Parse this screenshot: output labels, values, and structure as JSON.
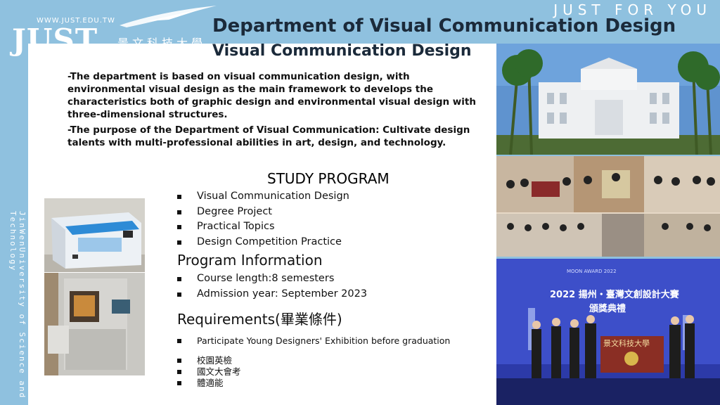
{
  "header": {
    "logo_text": "JUST",
    "logo_url": "WWW.JUST.EDU.TW",
    "logo_chinese": "景文科技大學",
    "slogan": "JUST FOR YOU",
    "title": "Department of Visual Communication Design",
    "subtitle": "Visual Communication Design"
  },
  "side_text": "JinWenUniversity of Science and Technology",
  "intro": {
    "p1": "-The department is based on visual communication design, with environmental visual design as the main framework to develops the characteristics both of graphic design and environmental visual design with three-dimensional structures.",
    "p2": "-The purpose of the Department of Visual Communication: Cultivate design talents with multi-professional abilities in art, design, and technology."
  },
  "study_program": {
    "heading": "STUDY PROGRAM",
    "items": [
      "Visual Communication Design",
      "Degree Project",
      "Practical Topics",
      "Design Competition Practice"
    ]
  },
  "program_info": {
    "heading": "Program Information",
    "items": [
      "Course length:8 semesters",
      "Admission year: September 2023"
    ]
  },
  "requirements": {
    "heading": "Requirements(畢業條件)",
    "items": [
      "Participate Young Designers' Exhibition before graduation"
    ],
    "items_cn": [
      "校園英檢",
      "國文大會考",
      "體適能"
    ]
  },
  "photos": {
    "award_banner_line1": "2022 揚州・臺灣文創設計大賽",
    "award_banner_line2": "頒獎典禮",
    "award_top": "MOON AWARD 2022",
    "student_banner": "景文科技大學",
    "group_banner": "景文科技大學"
  },
  "colors": {
    "frame": "#8fc1df",
    "title": "#1b2a3a",
    "award_bg": "#3b48c0"
  }
}
